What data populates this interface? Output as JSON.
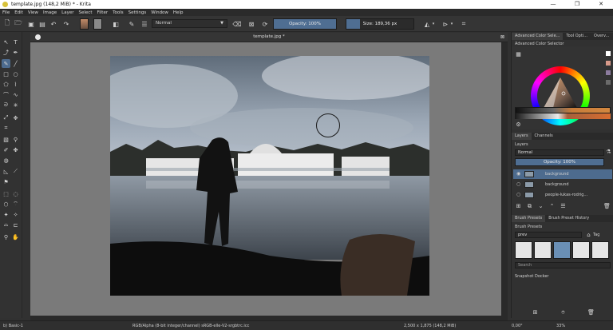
{
  "window": {
    "title": "template.jpg (148,2 MiB)  * - Krita",
    "minimize": "—",
    "maximize": "❐",
    "close": "✕"
  },
  "menu": [
    "File",
    "Edit",
    "View",
    "Image",
    "Layer",
    "Select",
    "Filter",
    "Tools",
    "Settings",
    "Window",
    "Help"
  ],
  "toolbar": {
    "blend_mode": "Normal",
    "opacity_label": "Opacity: 100%",
    "opacity_value": 1.0,
    "size_label": "Size: 189,36 px",
    "size_fill": 0.2,
    "fg_color": "#c08a67",
    "bg_color": "#8a8a8a"
  },
  "document": {
    "tab_title": "template.jpg *"
  },
  "dock": {
    "tabs": [
      "Advanced Color Sele...",
      "Tool Opti...",
      "Overv..."
    ],
    "color_selector_title": "Advanced Color Selector",
    "layers_tabs": [
      "Layers",
      "Channels"
    ],
    "layers_title": "Layers",
    "layer_blend": "Normal",
    "layer_opacity": "Opacity:  100%",
    "layers": [
      {
        "name": "background",
        "selected": true
      },
      {
        "name": "background",
        "selected": false
      },
      {
        "name": "people-lukas-rodrig...",
        "selected": false
      }
    ],
    "brush_tabs": [
      "Brush Presets",
      "Brush Preset History"
    ],
    "brush_presets_title": "Brush Presets",
    "brush_filter": "prev",
    "brush_tag": "Tag",
    "search_placeholder": "Search",
    "snapshot_title": "Snapshot Docker"
  },
  "status": {
    "brush": "b) Basic-1",
    "color_model": "RGB/Alpha (8-bit integer/channel)  sRGB-elle-V2-srgbtrc.icc",
    "dimensions": "2,500 x 1,875 (148,2 MiB)",
    "rotation": "0,00°",
    "zoom": "33%"
  }
}
